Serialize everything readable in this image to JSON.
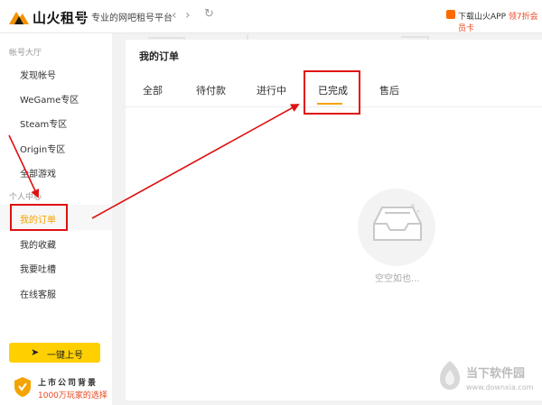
{
  "header": {
    "logo_text": "山火租号",
    "tagline": "专业的网吧租号平台",
    "download_text": "下载山火APP",
    "download_promo": "领7折会员卡"
  },
  "sidebar": {
    "section1_title": "帐号大厅",
    "items1": [
      "发现帐号",
      "WeGame专区",
      "Steam专区",
      "Origin专区",
      "全部游戏"
    ],
    "section2_title": "个人中心",
    "items2": [
      "我的订单",
      "我的收藏",
      "我要吐槽",
      "在线客服"
    ],
    "quick_button": "一键上号",
    "badge_title": "上市公司背景",
    "badge_sub": "1000万玩家的选择"
  },
  "main": {
    "title": "我的订单",
    "tabs": [
      "全部",
      "待付款",
      "进行中",
      "已完成",
      "售后"
    ],
    "active_tab": "已完成",
    "empty_text": "空空如也..."
  },
  "watermark": {
    "title": "当下软件园",
    "url": "www.downxia.com"
  },
  "colors": {
    "accent": "#f5a300",
    "highlight": "#e01010",
    "quick_button": "#ffd000"
  }
}
